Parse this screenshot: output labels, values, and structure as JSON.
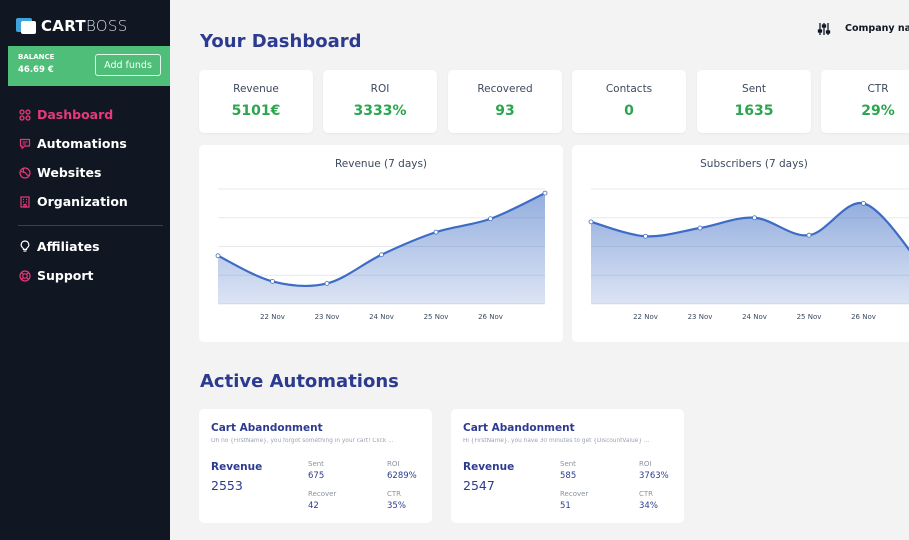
{
  "brand": {
    "name_bold": "CART",
    "name_light": "BOSS"
  },
  "balance": {
    "label": "BALANCE",
    "value": "46.69 €",
    "button": "Add funds"
  },
  "nav": [
    {
      "label": "Dashboard",
      "icon": "dashboard-icon",
      "active": true
    },
    {
      "label": "Automations",
      "icon": "chat-icon",
      "active": false
    },
    {
      "label": "Websites",
      "icon": "globe-icon",
      "active": false
    },
    {
      "label": "Organization",
      "icon": "building-icon",
      "active": false
    },
    {
      "label": "Affiliates",
      "icon": "lightbulb-icon",
      "active": false
    },
    {
      "label": "Support",
      "icon": "lifebuoy-icon",
      "active": false
    }
  ],
  "header": {
    "title": "Your Dashboard",
    "company": "Company name"
  },
  "stats": [
    {
      "label": "Revenue",
      "value": "5101€"
    },
    {
      "label": "ROI",
      "value": "3333%"
    },
    {
      "label": "Recovered",
      "value": "93"
    },
    {
      "label": "Contacts",
      "value": "0"
    },
    {
      "label": "Sent",
      "value": "1635"
    },
    {
      "label": "CTR",
      "value": "29%"
    }
  ],
  "chart_data": [
    {
      "type": "area",
      "title": "Revenue (7 days)",
      "categories": [
        "",
        "22 Nov",
        "23 Nov",
        "24 Nov",
        "25 Nov",
        "26 Nov",
        ""
      ],
      "values": [
        35,
        10,
        8,
        36,
        58,
        71,
        96
      ],
      "ylim": [
        -12,
        100
      ],
      "grid": true,
      "color": "#3d6cc4"
    },
    {
      "type": "area",
      "title": "Subscribers (7 days)",
      "categories": [
        "",
        "22 Nov",
        "23 Nov",
        "24 Nov",
        "25 Nov",
        "26 Nov",
        ""
      ],
      "values": [
        68,
        54,
        62,
        72,
        55,
        86,
        30
      ],
      "ylim": [
        -12,
        100
      ],
      "grid": true,
      "color": "#3d6cc4"
    }
  ],
  "automations_title": "Active Automations",
  "automations": [
    {
      "name": "Cart Abandonment",
      "desc": "Oh no {FirstName}, you forgot something in your cart! Click ...",
      "revenue_label": "Revenue",
      "revenue": "2553",
      "sent_label": "Sent",
      "sent": "675",
      "roi_label": "ROI",
      "roi": "6289%",
      "recover_label": "Recover",
      "recover": "42",
      "ctr_label": "CTR",
      "ctr": "35%"
    },
    {
      "name": "Cart Abandonment",
      "desc": "Hi {FirstName}, you have 30 minutes to get {DiscountValue} ...",
      "revenue_label": "Revenue",
      "revenue": "2547",
      "sent_label": "Sent",
      "sent": "585",
      "roi_label": "ROI",
      "roi": "3763%",
      "recover_label": "Recover",
      "recover": "51",
      "ctr_label": "CTR",
      "ctr": "34%"
    }
  ],
  "colors": {
    "accent": "#e8387a",
    "brand": "#2c3b8f",
    "positive": "#2ca550",
    "balance": "#4ebe78",
    "sidebar": "#111722"
  }
}
